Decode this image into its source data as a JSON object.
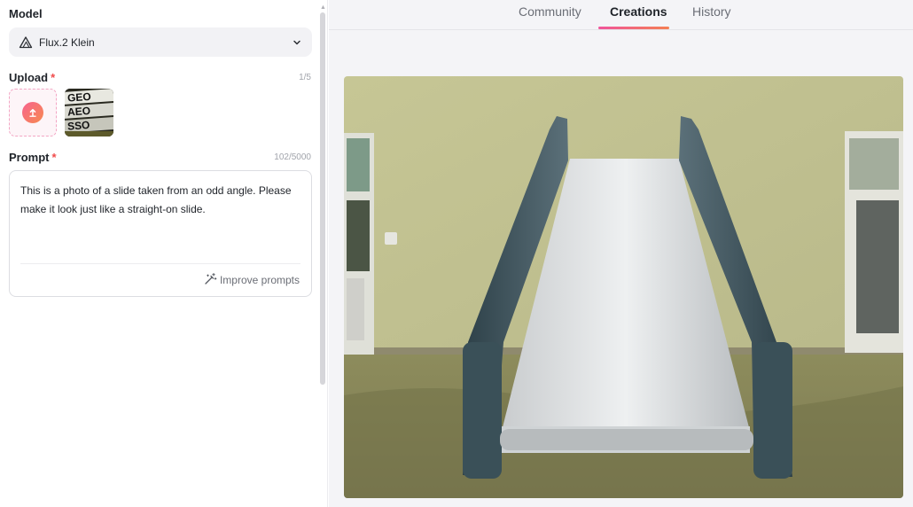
{
  "model": {
    "label": "Model",
    "selected": "Flux.2 Klein"
  },
  "upload": {
    "label": "Upload",
    "required_mark": "*",
    "count": "1/5",
    "thumbnail_text": [
      "GEO",
      "AEO",
      "SSO"
    ]
  },
  "prompt": {
    "label": "Prompt",
    "required_mark": "*",
    "count": "102/5000",
    "value": "This is a photo of a slide taken from an odd angle. Please make it look just like a straight-on slide.",
    "improve_label": "Improve prompts"
  },
  "tabs": [
    {
      "label": "Community",
      "active": false
    },
    {
      "label": "Creations",
      "active": true
    },
    {
      "label": "History",
      "active": false
    }
  ],
  "colors": {
    "accent_start": "#f0559b",
    "accent_end": "#f47f53",
    "required": "#f04b4b"
  },
  "icons": {
    "model": "triangle-mountain-icon",
    "dropdown": "chevron-down-icon",
    "upload": "upload-arrow-icon",
    "improve": "magic-wand-icon"
  }
}
